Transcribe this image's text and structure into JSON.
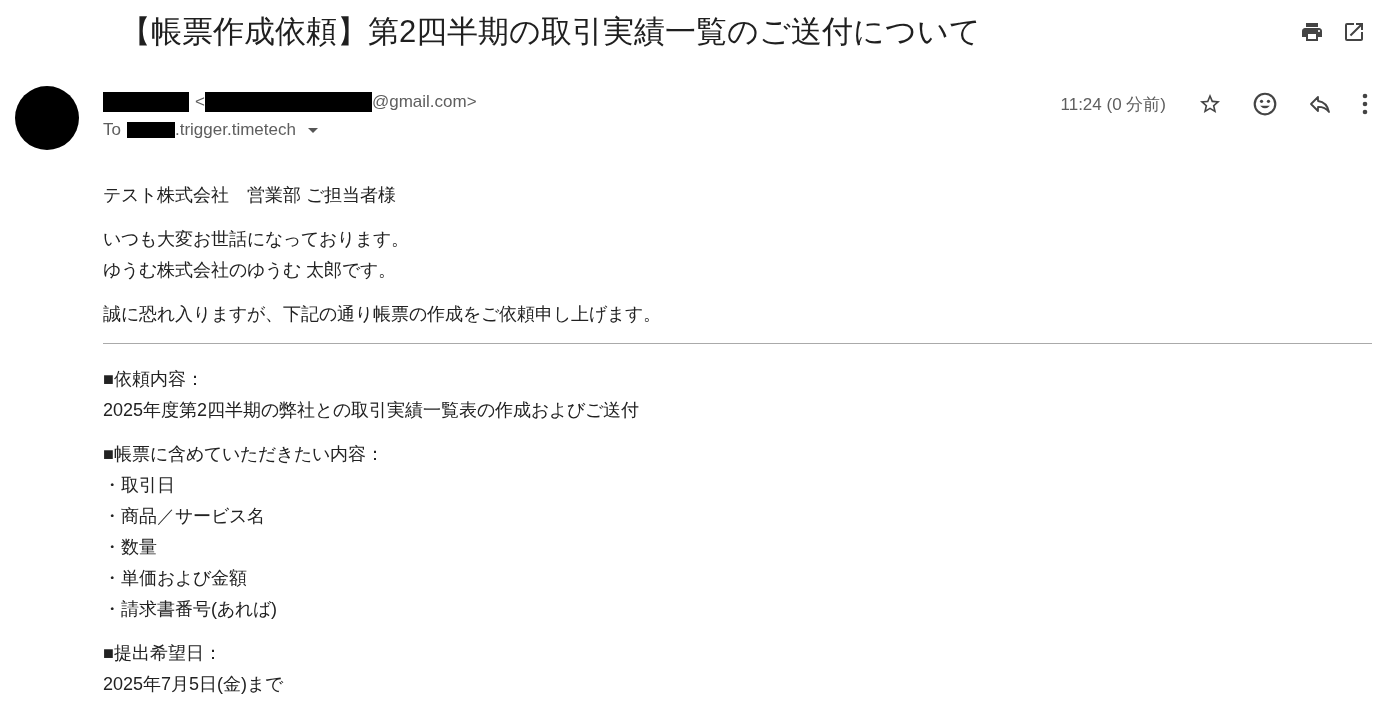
{
  "subject": "【帳票作成依頼】第2四半期の取引実績一覧のご送付について",
  "sender": {
    "email_open": "<",
    "email_domain": "@gmail.com>"
  },
  "recipient": {
    "label": "To",
    "address_domain": ".trigger.timetech"
  },
  "time": "11:24 (0 分前)",
  "body": [
    {
      "kind": "paragraph",
      "lines": [
        "テスト株式会社　営業部 ご担当者様"
      ]
    },
    {
      "kind": "paragraph",
      "lines": [
        "いつも大変お世話になっております。",
        "ゆうむ株式会社のゆうむ 太郎です。"
      ]
    },
    {
      "kind": "paragraph",
      "lines": [
        "誠に恐れ入りますが、下記の通り帳票の作成をご依頼申し上げます。"
      ]
    },
    {
      "kind": "rule"
    },
    {
      "kind": "paragraph",
      "lines": [
        "■依頼内容：",
        "2025年度第2四半期の弊社との取引実績一覧表の作成およびご送付"
      ]
    },
    {
      "kind": "paragraph",
      "lines": [
        "■帳票に含めていただきたい内容：",
        "・取引日",
        "・商品／サービス名",
        "・数量",
        "・単価および金額",
        "・請求書番号(あれば)"
      ]
    },
    {
      "kind": "paragraph",
      "lines": [
        "■提出希望日：",
        "2025年7月5日(金)まで"
      ]
    }
  ]
}
